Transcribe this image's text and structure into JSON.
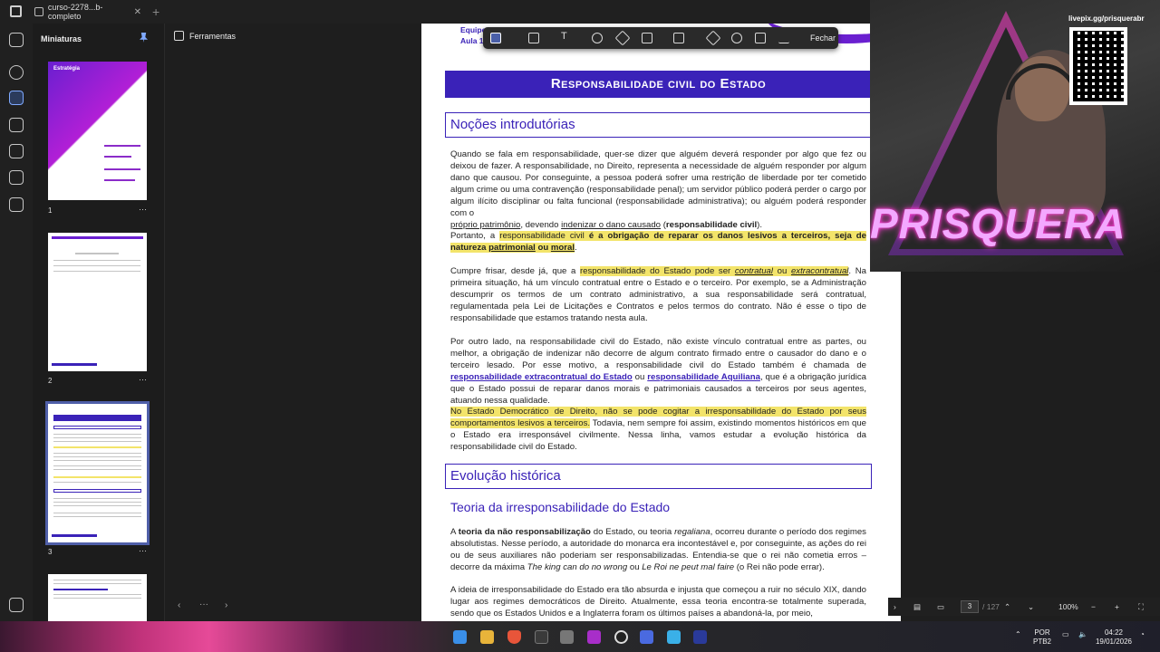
{
  "tab": {
    "title": "curso-2278...b-completo"
  },
  "thumbnails": {
    "title": "Miniaturas",
    "pages": [
      "1",
      "2",
      "3"
    ],
    "cover_brand": "Estratégia"
  },
  "tools_label": "Ferramentas",
  "toolbar": {
    "close_label": "Fechar"
  },
  "doc": {
    "header_text": [
      "Equipe",
      "Aula 1"
    ],
    "title": "Responsabilidade civil do Estado",
    "section1": "Noções introdutórias",
    "p1": "Quando se fala em responsabilidade, quer-se dizer que alguém deverá responder por algo que fez ou deixou de fazer. A responsabilidade, no Direito, representa a necessidade de alguém responder por algum dano que causou. Por conseguinte, a pessoa poderá sofrer uma restrição de liberdade por ter cometido algum crime ou uma contravenção (responsabilidade penal); um servidor público poderá perder o cargo por algum ilícito disciplinar ou falta funcional (responsabilidade administrativa); ou alguém poderá responder com o",
    "p1_a": "próprio patrimônio",
    "p1_b": ", devendo ",
    "p1_c": "indenizar o dano causado",
    "p1_d": " (",
    "p1_e": "responsabilidade civil",
    "p1_f": ").",
    "p2_a": "Portanto, a ",
    "p2_b": "responsabilidade civil",
    "p2_c": " é a obrigação de reparar os danos lesivos a terceiros, seja de natureza ",
    "p2_d": "patrimonial",
    "p2_e": " ou ",
    "p2_f": "moral",
    "p2_g": ".",
    "p3_a": "Cumpre frisar, desde já, que a ",
    "p3_b": "responsabilidade do Estado pode ser ",
    "p3_c": "contratual",
    "p3_d": " ou ",
    "p3_e": "extracontratual",
    "p3_f": ". Na primeira situação, há um vínculo contratual entre o Estado e o terceiro. Por exemplo, se a Administração descumprir os termos de um contrato administrativo, a sua responsabilidade será contratual, regulamentada pela Lei de Licitações e Contratos e pelos termos do contrato. Não é esse o tipo de responsabilidade que estamos tratando nesta aula.",
    "p4_a": "Por outro lado, na responsabilidade civil do Estado, não existe vínculo contratual entre as partes, ou melhor, a obrigação de indenizar não decorre de algum contrato firmado entre o causador do dano e o terceiro lesado. Por esse motivo, a responsabilidade civil do Estado também é chamada de ",
    "p4_b": "responsabilidade extracontratual do Estado",
    "p4_c": " ou ",
    "p4_d": "responsabilidade Aquiliana",
    "p4_e": ", que é a obrigação jurídica que o Estado possui de reparar danos morais e patrimoniais causados a terceiros por seus agentes, atuando nessa qualidade.",
    "p5_a": "No Estado Democrático de Direito, não se pode cogitar a irresponsabilidade do Estado por seus comportamentos lesivos a terceiros.",
    "p5_b": " Todavia, nem sempre foi assim, existindo momentos históricos em que o Estado era irresponsável civilmente. Nessa linha, vamos estudar a evolução histórica da responsabilidade civil do Estado.",
    "section2": "Evolução histórica",
    "subsection": "Teoria da irresponsabilidade do Estado",
    "p6_a": "A ",
    "p6_b": "teoria da não responsabilização",
    "p6_c": " do Estado, ou teoria ",
    "p6_d": "regaliana",
    "p6_e": ", ocorreu durante o período dos regimes absolutistas. Nesse período, a autoridade do monarca era incontestável e, por conseguinte, as ações do rei ou de seus auxiliares não poderiam ser responsabilizadas. Entendia-se que o rei não cometia erros – decorre da máxima ",
    "p6_f": "The king can do no wrong",
    "p6_g": " ou ",
    "p6_h": "Le Roi ne peut mal faire",
    "p6_i": " (o Rei não pode errar).",
    "p7": "A ideia de irresponsabilidade do Estado era tão absurda e injusta que começou a ruir no século XIX, dando lugar aos regimes democráticos de Direito. Atualmente, essa teoria encontra-se totalmente superada, sendo que os Estados Unidos e a Inglaterra foram os últimos países a abandoná-la, por meio,"
  },
  "status": {
    "page": "3",
    "total": "/ 127",
    "zoom": "100%"
  },
  "stream": {
    "url": "livepix.gg/prisquerabr",
    "name": "PRISQUERA"
  },
  "taskbar": {
    "lang1": "POR",
    "lang2": "PTB2",
    "time": "04:22",
    "date": "19/01/2026"
  },
  "colors": {
    "accent": "#3a22b8",
    "highlight": "#f3e46a",
    "toolbar": "#2a2a2a"
  }
}
